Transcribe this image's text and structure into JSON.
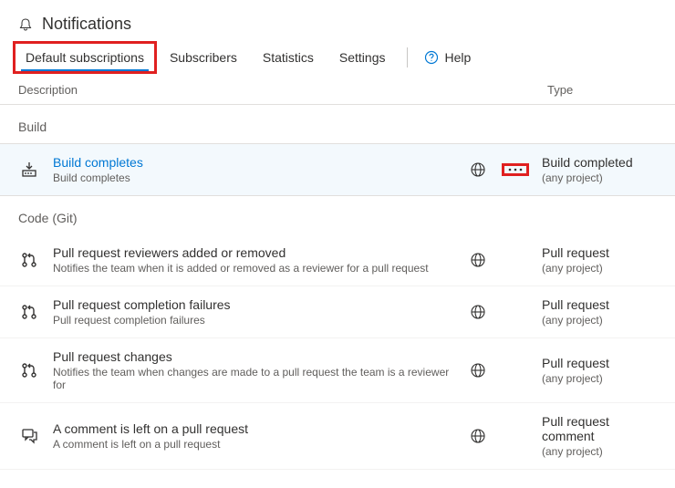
{
  "header": {
    "title": "Notifications"
  },
  "tabs": {
    "items": [
      {
        "label": "Default subscriptions"
      },
      {
        "label": "Subscribers"
      },
      {
        "label": "Statistics"
      },
      {
        "label": "Settings"
      }
    ],
    "help_label": "Help"
  },
  "columns": {
    "description": "Description",
    "type": "Type"
  },
  "sections": [
    {
      "title": "Build",
      "rows": [
        {
          "icon": "build",
          "title": "Build completes",
          "sub": "Build completes",
          "selected": true,
          "link": true,
          "type_title": "Build completed",
          "type_sub": "(any project)"
        }
      ]
    },
    {
      "title": "Code (Git)",
      "rows": [
        {
          "icon": "pull-request",
          "title": "Pull request reviewers added or removed",
          "sub": "Notifies the team when it is added or removed as a reviewer for a pull request",
          "type_title": "Pull request",
          "type_sub": "(any project)"
        },
        {
          "icon": "pull-request",
          "title": "Pull request completion failures",
          "sub": "Pull request completion failures",
          "type_title": "Pull request",
          "type_sub": "(any project)"
        },
        {
          "icon": "pull-request",
          "title": "Pull request changes",
          "sub": "Notifies the team when changes are made to a pull request the team is a reviewer for",
          "type_title": "Pull request",
          "type_sub": "(any project)"
        },
        {
          "icon": "comment",
          "title": "A comment is left on a pull request",
          "sub": "A comment is left on a pull request",
          "type_title": "Pull request comment",
          "type_sub": "(any project)"
        }
      ]
    }
  ]
}
